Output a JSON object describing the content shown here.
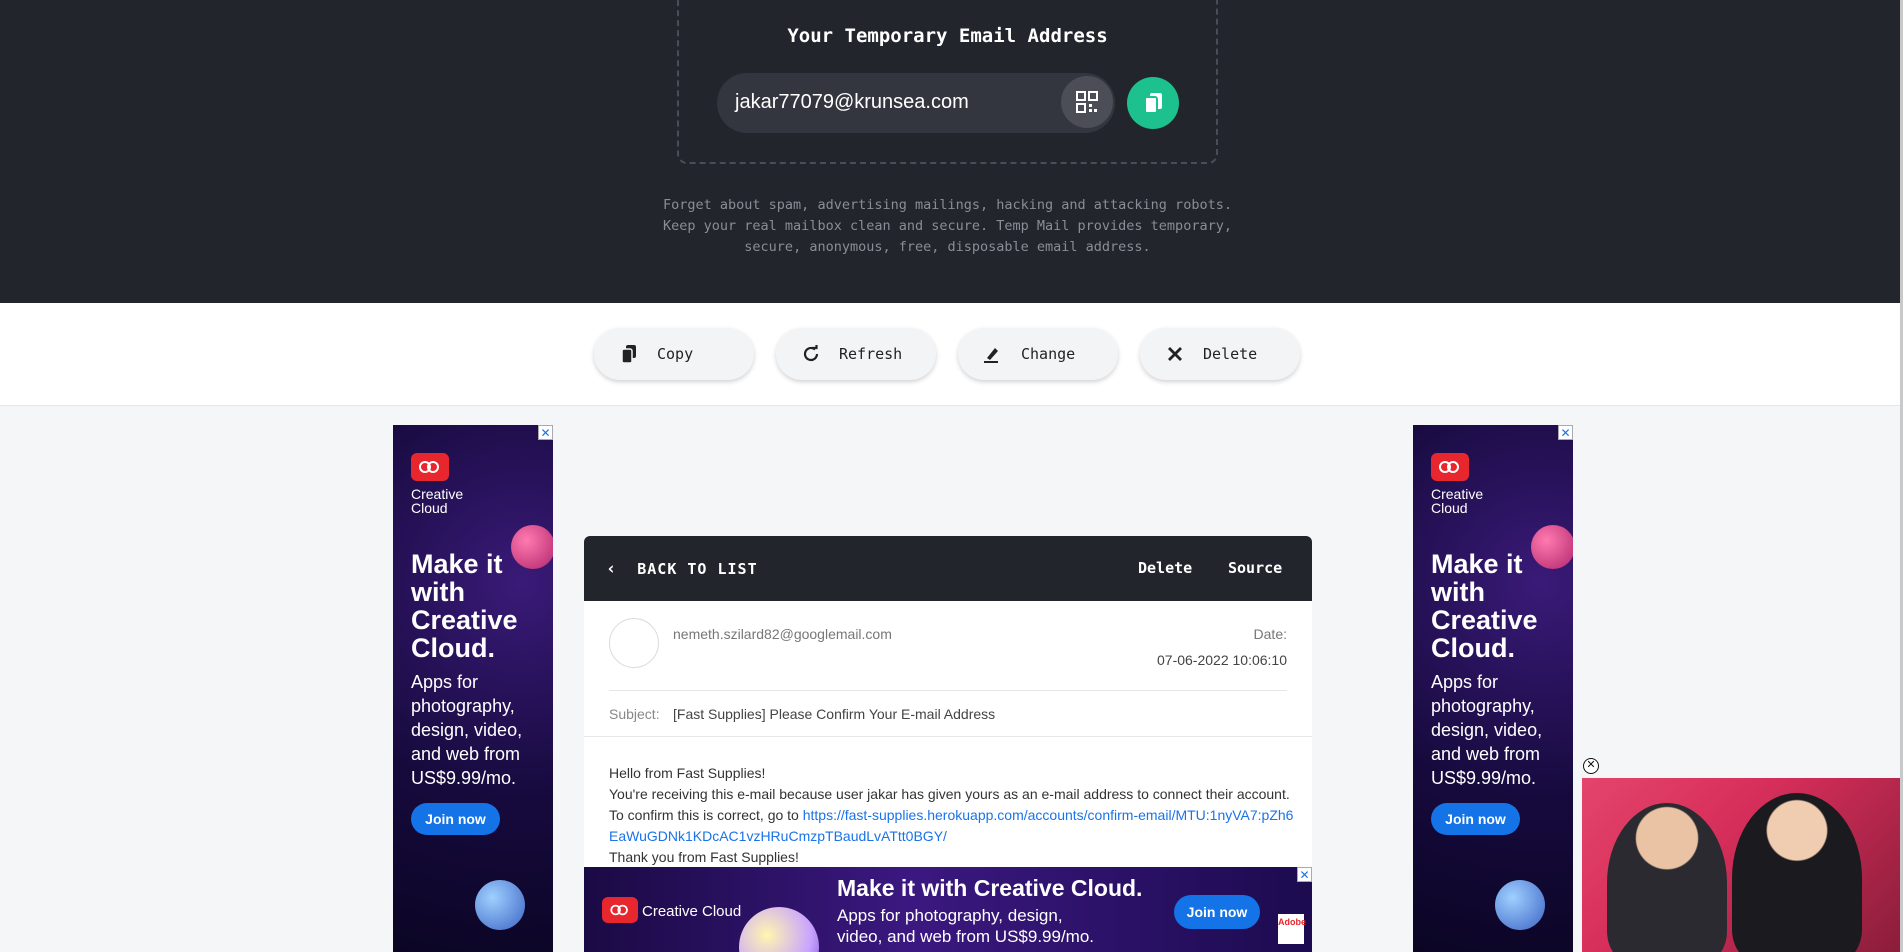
{
  "header": {
    "title": "Your Temporary Email Address",
    "email": "jakar77079@krunsea.com",
    "tagline": "Forget about spam, advertising mailings, hacking and attacking robots. Keep your real mailbox clean and secure. Temp Mail provides temporary, secure, anonymous, free, disposable email address."
  },
  "actions": {
    "copy": "Copy",
    "refresh": "Refresh",
    "change": "Change",
    "delete": "Delete"
  },
  "message": {
    "back_label": "BACK TO LIST",
    "delete_label": "Delete",
    "source_label": "Source",
    "from": "nemeth.szilard82@googlemail.com",
    "date_label": "Date:",
    "date": "07-06-2022 10:06:10",
    "subject_label": "Subject:",
    "subject": "[Fast Supplies] Please Confirm Your E-mail Address",
    "body_line1": "Hello from Fast Supplies!",
    "body_line2": "You're receiving this e-mail because user jakar has given yours as an e-mail address to connect their account.",
    "body_line3_prefix": "To confirm this is correct, go to ",
    "confirm_link": "https://fast-supplies.herokuapp.com/accounts/confirm-email/MTU:1nyVA7:pZh6EaWuGDNk1KDcAC1vzHRuCmzpTBaudLvATtt0BGY/",
    "body_line4": "Thank you from Fast Supplies!"
  },
  "side_ad": {
    "brand": "Creative Cloud",
    "headline": "Make it with Creative Cloud.",
    "sub": "Apps for photography, design, video, and web from US$9.99/mo.",
    "cta": "Join now",
    "close": "✕"
  },
  "bottom_ad": {
    "brand": "Creative Cloud",
    "headline": "Make it with Creative Cloud.",
    "sub": "Apps for photography, design, video, and web from US$9.99/mo.",
    "cta": "Join now",
    "adobe": "Adobe",
    "close": "✕"
  },
  "video": {
    "close": "✕"
  },
  "colors": {
    "header_bg": "#23252c",
    "accent_green": "#1dc18e",
    "link": "#1a73e8",
    "ad_blue": "#1473e6"
  }
}
